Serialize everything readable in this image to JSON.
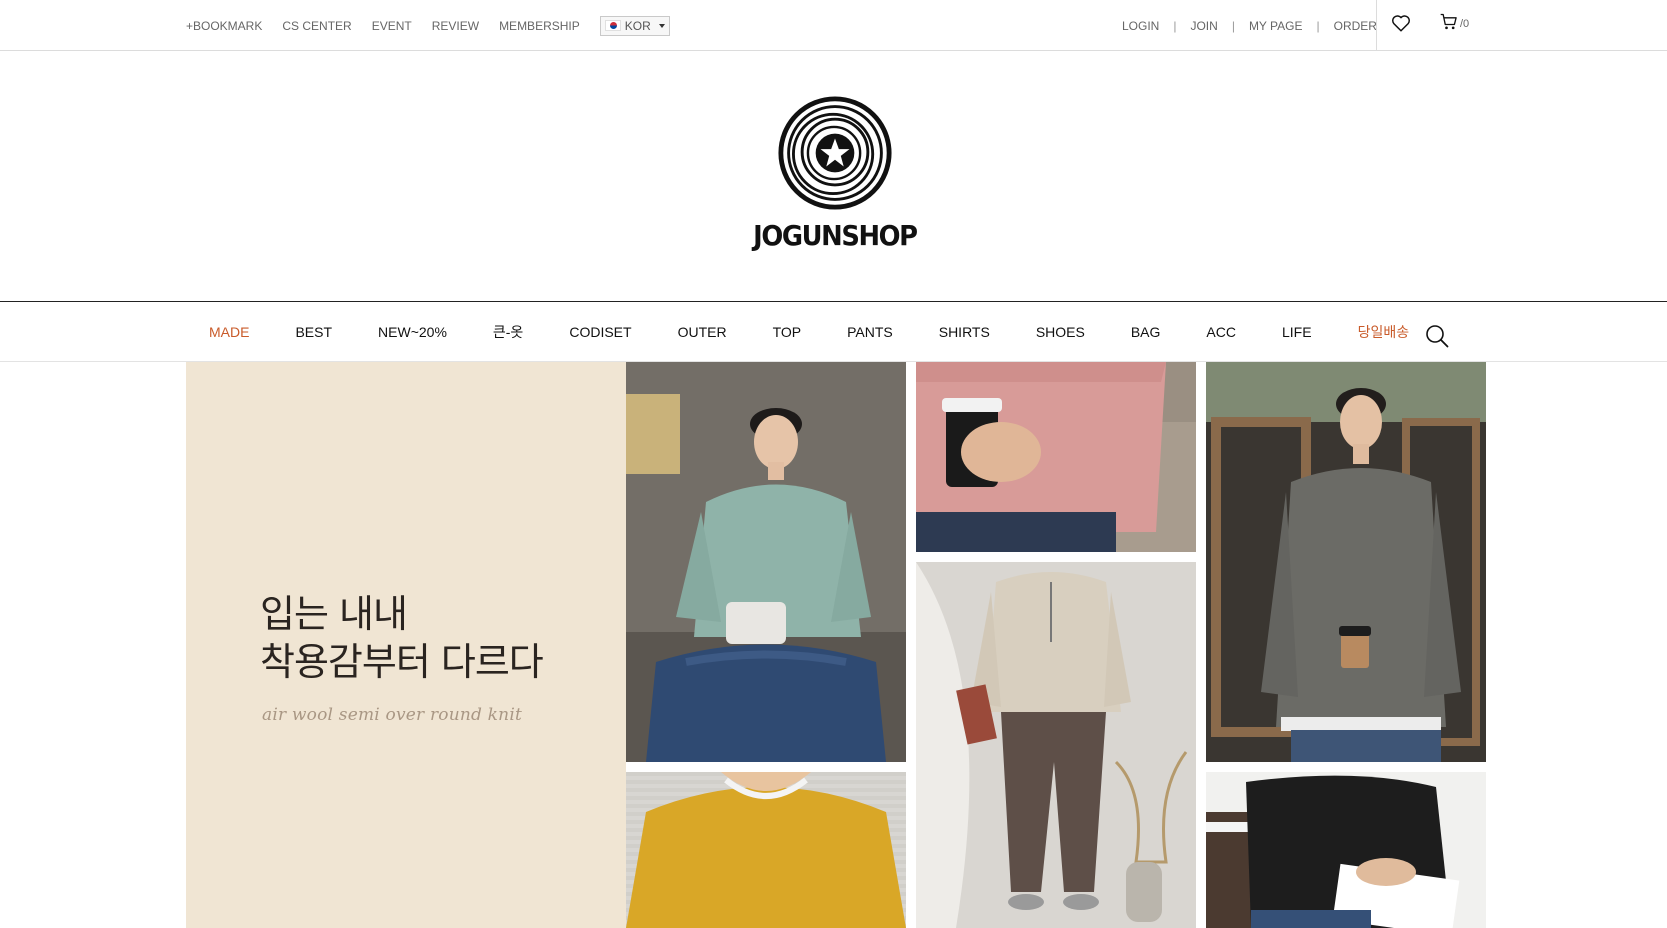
{
  "topbar": {
    "left_links": [
      "+BOOKMARK",
      "CS CENTER",
      "EVENT",
      "REVIEW",
      "MEMBERSHIP"
    ],
    "language": "KOR",
    "right_links": [
      "LOGIN",
      "JOIN",
      "MY PAGE",
      "ORDER"
    ],
    "separator": "|",
    "cart_count": "/0"
  },
  "logo": {
    "text": "JOGUNSHOP"
  },
  "nav": {
    "items": [
      "MADE",
      "BEST",
      "NEW~20%",
      "큰-옷",
      "CODISET",
      "OUTER",
      "TOP",
      "PANTS",
      "SHIRTS",
      "SHOES",
      "BAG",
      "ACC",
      "LIFE",
      "당일배송"
    ]
  },
  "hero": {
    "headline_line1": "입는 내내",
    "headline_line2": "착용감부터 다르다",
    "subtitle": "air wool semi over round knit"
  },
  "colors": {
    "accent": "#c95b2a",
    "hero_panel": "#f0e5d3",
    "mint_sweater": "#8fb3a9",
    "pink_sweater": "#d89b98",
    "beige_sweater": "#d8cfbf",
    "gray_sweater": "#6b6b66",
    "yellow_sweater": "#d9a727",
    "black_sweater": "#1d1d1d"
  },
  "icons": [
    "heart-icon",
    "cart-icon",
    "search-icon",
    "logo-mark-icon",
    "flag-kr-icon",
    "chevron-down-icon"
  ]
}
